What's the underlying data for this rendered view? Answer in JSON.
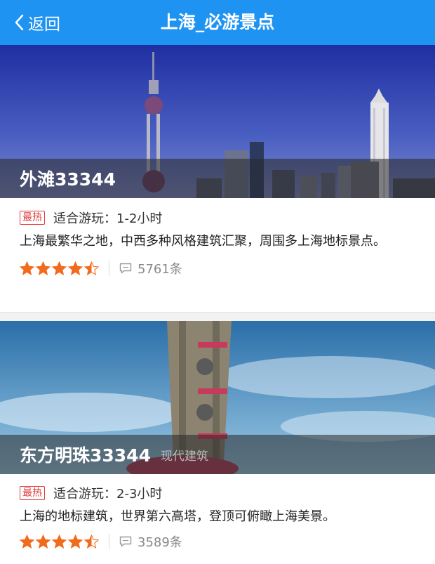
{
  "header": {
    "back_label": "返回",
    "title": "上海_必游景点"
  },
  "spots": [
    {
      "name": "外滩33344",
      "tag": "",
      "badge": "最热",
      "duration_label": "适合游玩：",
      "duration": "1-2小时",
      "description": "上海最繁华之地，中西多种风格建筑汇聚，周围多上海地标景点。",
      "rating": 4.5,
      "comments": "5761条"
    },
    {
      "name": "东方明珠33344",
      "tag": "现代建筑",
      "badge": "最热",
      "duration_label": "适合游玩：",
      "duration": "2-3小时",
      "description": "上海的地标建筑，世界第六高塔，登顶可俯瞰上海美景。",
      "rating": 4.5,
      "comments": "3589条"
    }
  ],
  "colors": {
    "accent": "#1e93f2",
    "star": "#f26a1b",
    "badge": "#e23a3a"
  },
  "icons": {
    "back": "chevron-left-icon",
    "comment": "comment-icon",
    "star": "star-icon"
  }
}
